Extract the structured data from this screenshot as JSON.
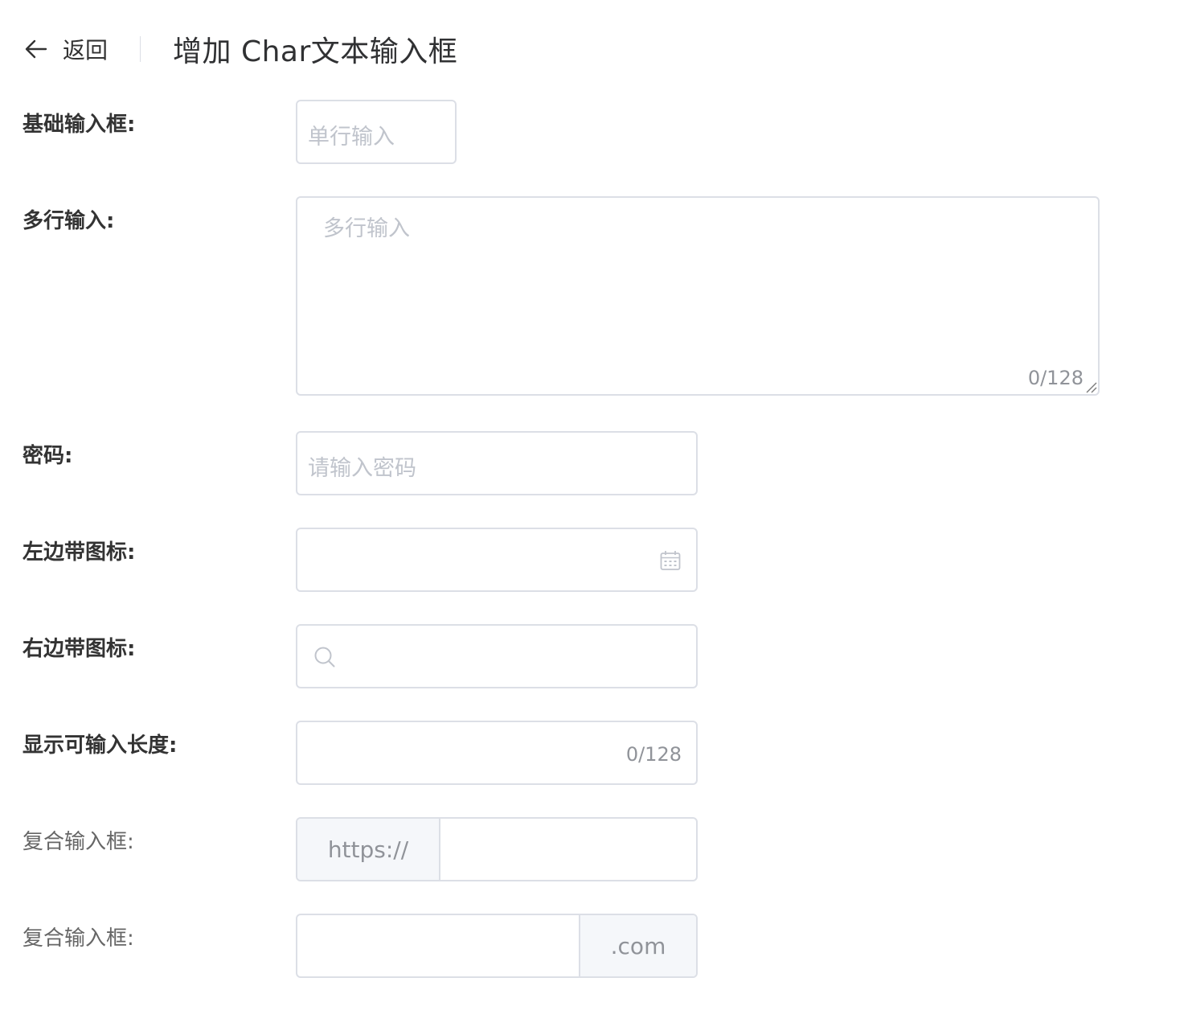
{
  "header": {
    "back_label": "返回",
    "title": "增加 Char文本输入框"
  },
  "form": {
    "basic": {
      "label": "基础输入框:",
      "placeholder": "单行输入"
    },
    "multiline": {
      "label": "多行输入:",
      "placeholder": "多行输入",
      "count": "0/128"
    },
    "password": {
      "label": "密码:",
      "placeholder": "请输入密码"
    },
    "left_icon": {
      "label": "左边带图标:",
      "icon": "calendar-icon"
    },
    "right_icon": {
      "label": "右边带图标:",
      "icon": "search-icon"
    },
    "show_length": {
      "label": "显示可输入长度:",
      "count": "0/128"
    },
    "composite_prefix": {
      "label": "复合输入框:",
      "prefix": "https://"
    },
    "composite_suffix": {
      "label": "复合输入框:",
      "suffix": ".com"
    }
  },
  "colors": {
    "border": "#dcdfe6",
    "placeholder": "#c0c4cc",
    "addon_bg": "#f5f7fa",
    "label": "#333333"
  }
}
